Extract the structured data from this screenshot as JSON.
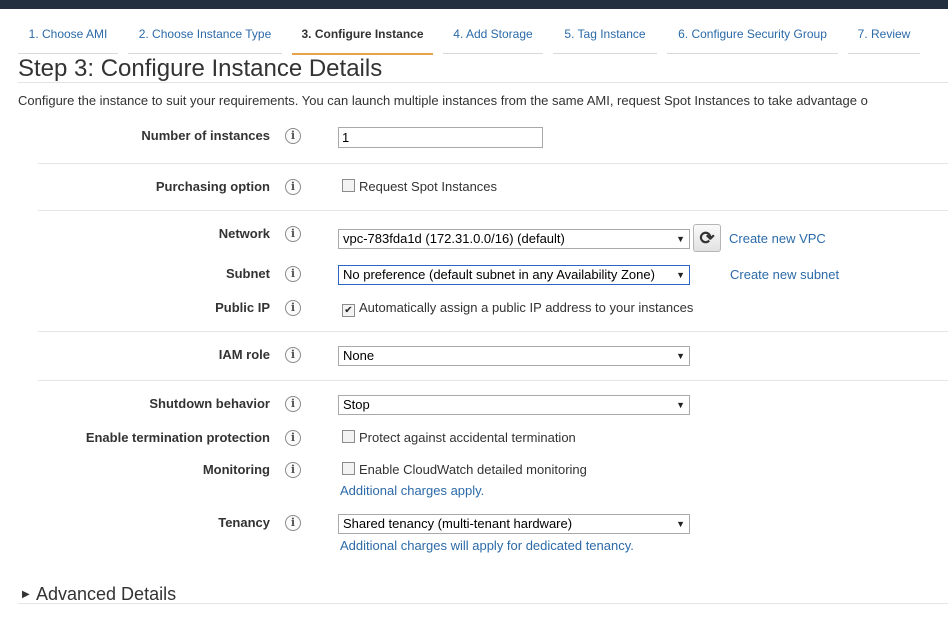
{
  "wizard": {
    "tabs": [
      {
        "label": "1. Choose AMI",
        "active": false
      },
      {
        "label": "2. Choose Instance Type",
        "active": false
      },
      {
        "label": "3. Configure Instance",
        "active": true
      },
      {
        "label": "4. Add Storage",
        "active": false
      },
      {
        "label": "5. Tag Instance",
        "active": false
      },
      {
        "label": "6. Configure Security Group",
        "active": false
      },
      {
        "label": "7. Review",
        "active": false
      }
    ]
  },
  "page": {
    "title": "Step 3: Configure Instance Details",
    "description": "Configure the instance to suit your requirements. You can launch multiple instances from the same AMI, request Spot Instances to take advantage o"
  },
  "form": {
    "info_glyph": "i",
    "num_instances": {
      "label": "Number of instances",
      "value": "1"
    },
    "purchasing": {
      "label": "Purchasing option",
      "checkbox_label": "Request Spot Instances",
      "checked": false
    },
    "network": {
      "label": "Network",
      "value": "vpc-783fda1d (172.31.0.0/16) (default)",
      "link": "Create new VPC"
    },
    "subnet": {
      "label": "Subnet",
      "value": "No preference (default subnet in any Availability Zone)",
      "link": "Create new subnet"
    },
    "public_ip": {
      "label": "Public IP",
      "checkbox_label": "Automatically assign a public IP address to your instances",
      "checked": true
    },
    "iam_role": {
      "label": "IAM role",
      "value": "None"
    },
    "shutdown": {
      "label": "Shutdown behavior",
      "value": "Stop"
    },
    "termination": {
      "label": "Enable termination protection",
      "checkbox_label": "Protect against accidental termination",
      "checked": false
    },
    "monitoring": {
      "label": "Monitoring",
      "checkbox_label": "Enable CloudWatch detailed monitoring",
      "checked": false,
      "note": "Additional charges apply."
    },
    "tenancy": {
      "label": "Tenancy",
      "value": "Shared tenancy (multi-tenant hardware)",
      "note": "Additional charges will apply for dedicated tenancy."
    }
  },
  "advanced": {
    "label": "Advanced Details",
    "expanded": false
  },
  "icons": {
    "refresh": "refresh-icon",
    "dropdown": "chevron-down-icon",
    "info": "info-icon",
    "expand": "triangle-right-icon"
  },
  "colors": {
    "link": "#2c6aa8",
    "active_tab_underline": "#e8a24a",
    "topbar": "#232f3e"
  }
}
